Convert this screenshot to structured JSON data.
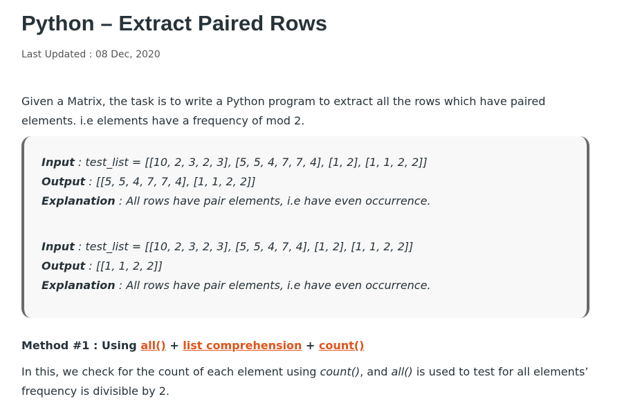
{
  "article": {
    "title": "Python – Extract Paired Rows",
    "last_updated": "Last Updated : 08 Dec, 2020",
    "intro": "Given a Matrix, the task is to write a Python program to extract all the rows which have paired elements. i.e elements have a frequency of mod 2."
  },
  "examples": [
    {
      "input_key": "Input",
      "input_val": " : test_list = [[10, 2, 3, 2, 3], [5, 5, 4, 7, 7, 4], [1, 2], [1, 1, 2, 2]]",
      "output_key": "Output",
      "output_val": " : [[5, 5, 4, 7, 7, 4], [1, 1, 2, 2]]",
      "explanation_key": "Explanation",
      "explanation_val": " : All rows have pair elements, i.e have even occurrence."
    },
    {
      "input_key": "Input",
      "input_val": " : test_list = [[10, 2, 3, 2, 3], [5, 5, 4, 7, 4], [1, 2], [1, 1, 2, 2]]",
      "output_key": "Output",
      "output_val": " : [[1, 1, 2, 2]]",
      "explanation_key": "Explanation",
      "explanation_val": " : All rows have pair elements, i.e have even occurrence."
    }
  ],
  "method": {
    "prefix": "Method #1 : Using ",
    "link_all": "all()",
    "plus1": " + ",
    "link_listcomp": "list comprehension",
    "plus2": " + ",
    "link_count": "count()",
    "link_color": "#e0541b"
  },
  "explain": {
    "part1": "In this, we check for the count of each element using ",
    "code1": "count()",
    "part2": ", and ",
    "code2": "all()",
    "part3": " is used to test for all elements’ frequency is divisible by 2."
  }
}
